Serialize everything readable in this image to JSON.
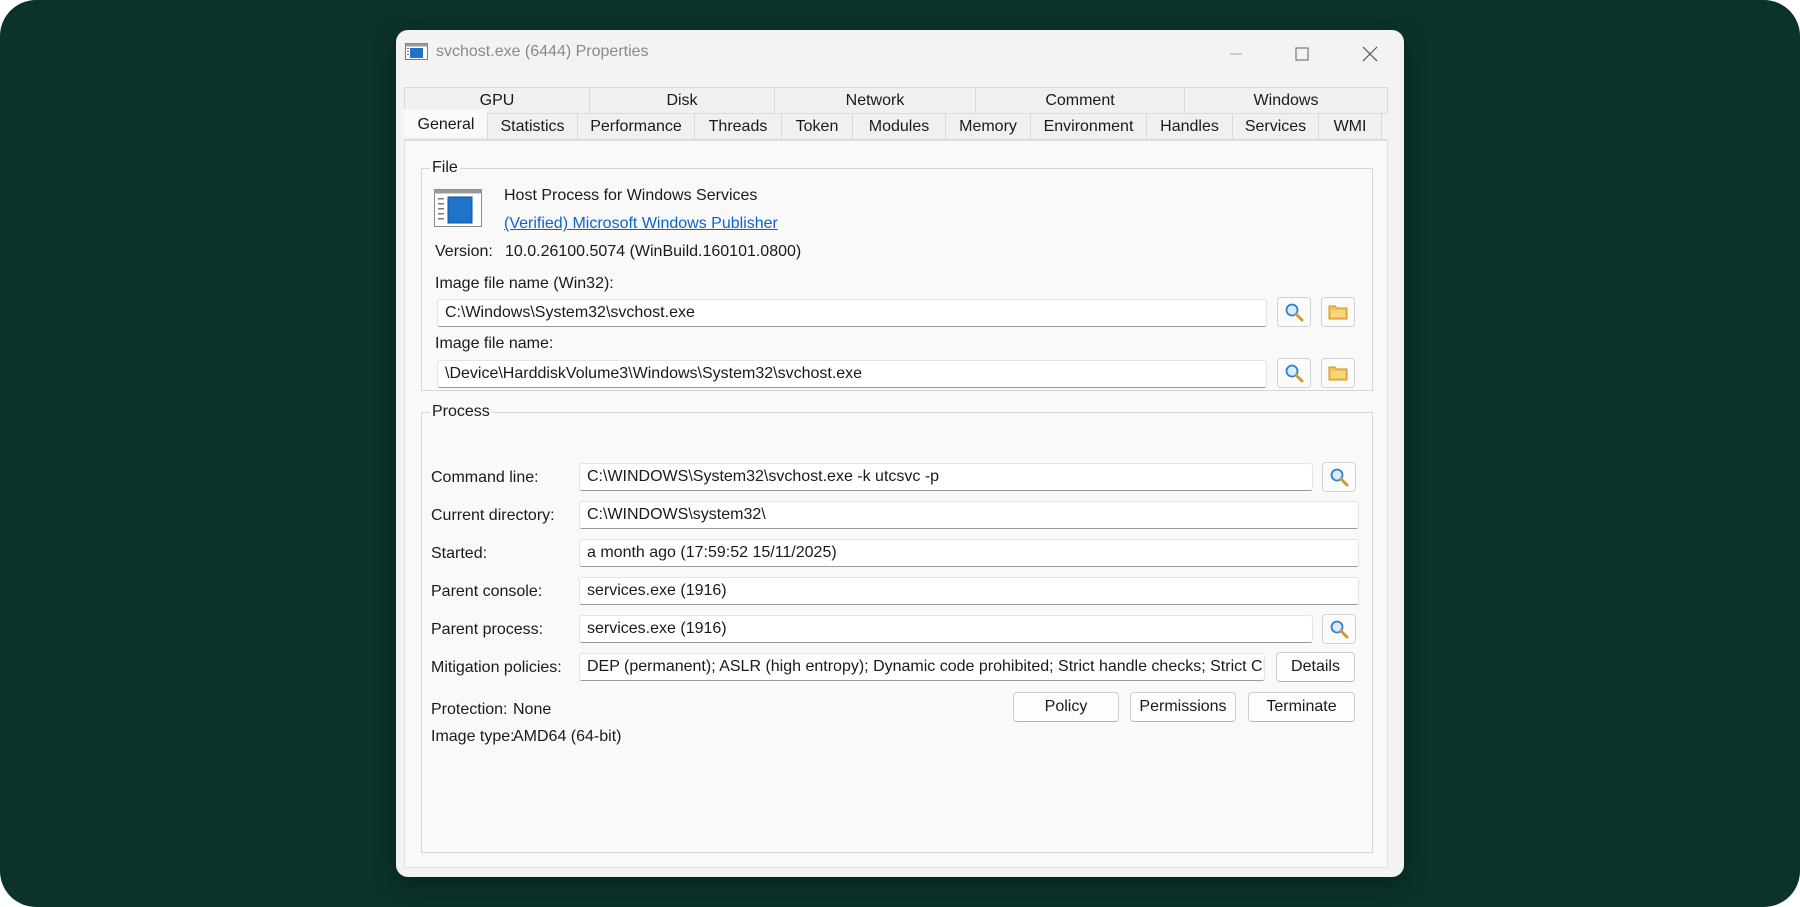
{
  "window": {
    "title": "svchost.exe (6444) Properties"
  },
  "tabs": {
    "row1": [
      "GPU",
      "Disk",
      "Network",
      "Comment",
      "Windows"
    ],
    "row2": [
      "General",
      "Statistics",
      "Performance",
      "Threads",
      "Token",
      "Modules",
      "Memory",
      "Environment",
      "Handles",
      "Services",
      "WMI"
    ],
    "active": "General"
  },
  "file": {
    "legend": "File",
    "description": "Host Process for Windows Services",
    "publisher_link": "(Verified) Microsoft Windows Publisher",
    "version_label": "Version:",
    "version_value": "10.0.26100.5074 (WinBuild.160101.0800)",
    "image_win32_label": "Image file name (Win32):",
    "image_win32_value": "C:\\Windows\\System32\\svchost.exe",
    "image_label": "Image file name:",
    "image_value": "\\Device\\HarddiskVolume3\\Windows\\System32\\svchost.exe"
  },
  "process": {
    "legend": "Process",
    "command_line_label": "Command line:",
    "command_line_value": "C:\\WINDOWS\\System32\\svchost.exe -k utcsvc -p",
    "current_dir_label": "Current directory:",
    "current_dir_value": "C:\\WINDOWS\\system32\\",
    "started_label": "Started:",
    "started_value": "a month ago (17:59:52 15/11/2025)",
    "parent_console_label": "Parent console:",
    "parent_console_value": "services.exe (1916)",
    "parent_process_label": "Parent process:",
    "parent_process_value": "services.exe (1916)",
    "mitigation_label": "Mitigation policies:",
    "mitigation_value": "DEP (permanent); ASLR (high entropy); Dynamic code prohibited; Strict handle checks; Strict CF",
    "details_button": "Details",
    "protection_label": "Protection:",
    "protection_value": "None",
    "image_type_label": "Image type:",
    "image_type_value": "AMD64 (64-bit)",
    "policy_button": "Policy",
    "permissions_button": "Permissions",
    "terminate_button": "Terminate"
  },
  "icons": {
    "search": "magnifier-icon",
    "folder": "folder-icon",
    "app": "window-app-icon"
  },
  "colors": {
    "backdrop": "#0b332b",
    "link": "#0b63ce",
    "folder": "#f2c14e"
  }
}
